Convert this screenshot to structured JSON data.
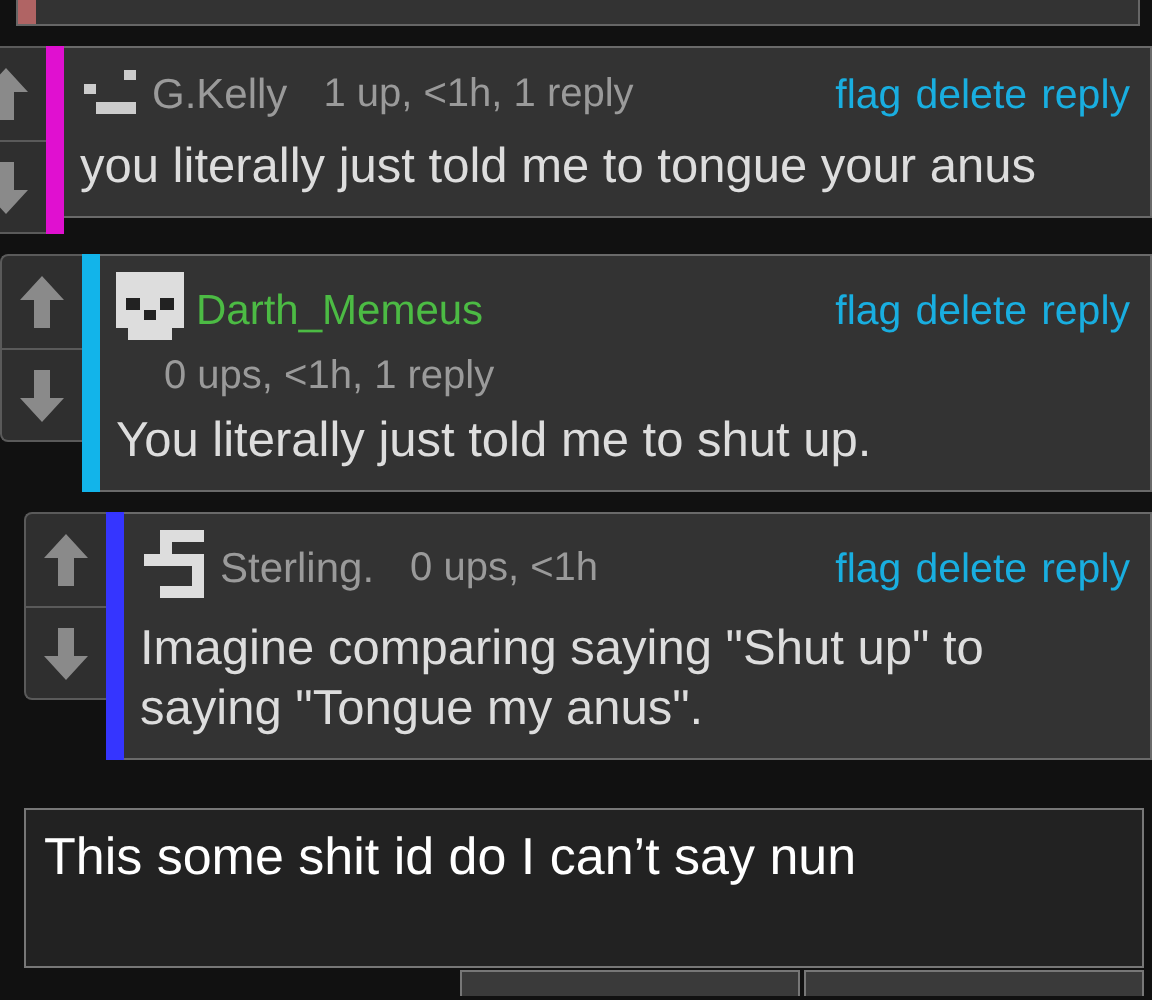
{
  "previous_comment": {
    "color": "#b06464"
  },
  "comments": [
    {
      "kind": "dash",
      "user": {
        "name": "G.Kelly",
        "color": "#9a9a9a"
      },
      "meta": "1 up, <1h, 1 reply",
      "meta_own_line": false,
      "color": "#e010d0",
      "actions": [
        "flag",
        "delete",
        "reply"
      ],
      "text": "you literally just told me to tongue your anus",
      "children": [
        {
          "kind": "skull",
          "user": {
            "name": "Darth_Memeus",
            "color": "#4cbb44"
          },
          "meta": "0 ups, <1h, 1 reply",
          "meta_own_line": true,
          "color": "#12b4ea",
          "actions": [
            "flag",
            "delete",
            "reply"
          ],
          "text": "You literally just told me to shut up.",
          "children": [
            {
              "kind": "glyph",
              "user": {
                "name": "Sterling.",
                "color": "#9a9a9a"
              },
              "meta": "0 ups, <1h",
              "meta_own_line": false,
              "color": "#3535ff",
              "actions": [
                "flag",
                "delete",
                "reply"
              ],
              "text": "Imagine comparing saying \"Shut up\" to saying \"Tongue my anus\"."
            }
          ]
        }
      ]
    }
  ],
  "reply_box": {
    "value": "This some shit id do I can’t say nun"
  }
}
